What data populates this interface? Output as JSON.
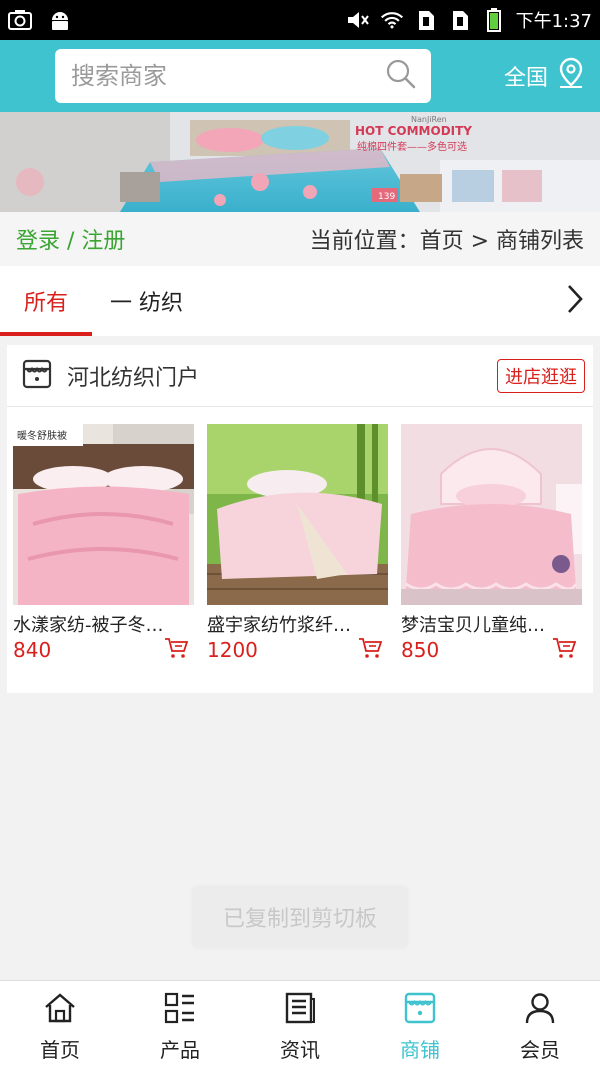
{
  "status_bar": {
    "time": "下午1:37",
    "icons": [
      "camera-icon",
      "android-icon",
      "mute-icon",
      "wifi-icon",
      "sim1-icon",
      "sim2-icon",
      "battery-icon"
    ]
  },
  "header": {
    "search_placeholder": "搜索商家",
    "region_label": "全国",
    "accent_color": "#3ec3cf"
  },
  "banner": {
    "headline": "HOT COMMODITY",
    "brand": "NanJiRen",
    "subline": "纯棉四件套——多色可选",
    "price": "139"
  },
  "breadcrumb_bar": {
    "login_label": "登录 / 注册",
    "location": "当前位置：首页 > 商铺列表"
  },
  "tabs": [
    {
      "label": "所有",
      "active": true
    },
    {
      "label": "一 纺织",
      "active": false
    }
  ],
  "store": {
    "name": "河北纺织门户",
    "enter_label": "进店逛逛",
    "products": [
      {
        "name": "水漾家纺-被子冬…",
        "price": "840",
        "image_label": "暖冬舒肤被"
      },
      {
        "name": "盛宇家纺竹浆纤…",
        "price": "1200"
      },
      {
        "name": "梦洁宝贝儿童纯…",
        "price": "850"
      }
    ]
  },
  "toast": "已复制到剪切板",
  "bottom_nav": [
    {
      "label": "首页",
      "icon": "home-icon",
      "active": false
    },
    {
      "label": "产品",
      "icon": "grid-list-icon",
      "active": false
    },
    {
      "label": "资讯",
      "icon": "document-icon",
      "active": false
    },
    {
      "label": "商铺",
      "icon": "store-icon",
      "active": true
    },
    {
      "label": "会员",
      "icon": "user-icon",
      "active": false
    }
  ],
  "colors": {
    "accent": "#3ec3cf",
    "price_red": "#d9201d",
    "login_green": "#3aa532"
  }
}
